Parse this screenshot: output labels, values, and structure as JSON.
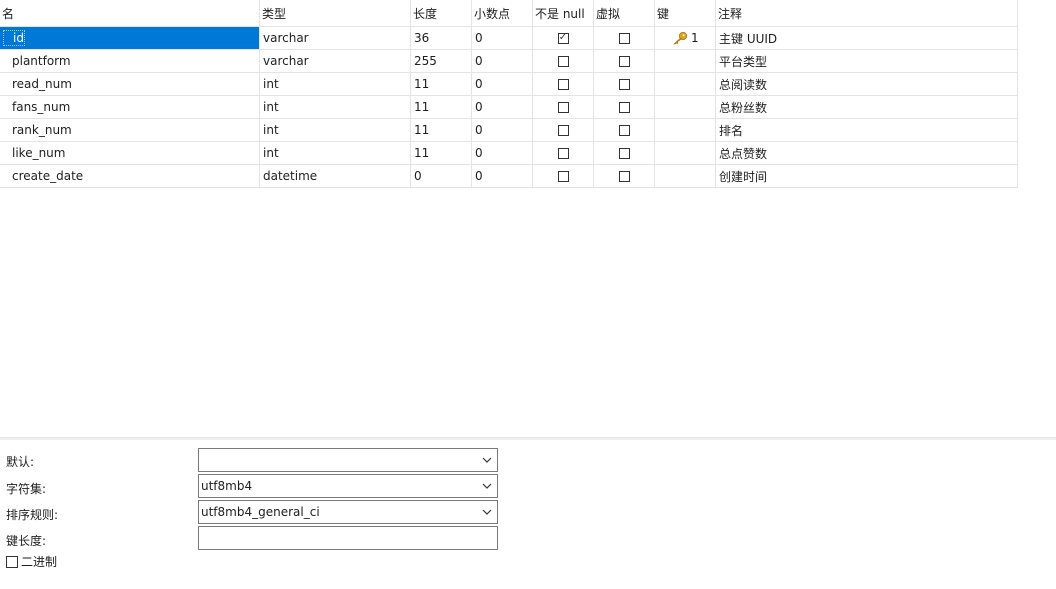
{
  "columns": {
    "name": "名",
    "type": "类型",
    "length": "长度",
    "decimals": "小数点",
    "not_null": "不是 null",
    "virtual": "虚拟",
    "key": "键",
    "comment": "注释"
  },
  "rows": [
    {
      "name": "id",
      "type": "varchar",
      "length": "36",
      "decimals": "0",
      "not_null": true,
      "virtual": false,
      "key": "1",
      "comment": "主键 UUID"
    },
    {
      "name": "plantform",
      "type": "varchar",
      "length": "255",
      "decimals": "0",
      "not_null": false,
      "virtual": false,
      "key": "",
      "comment": "平台类型"
    },
    {
      "name": "read_num",
      "type": "int",
      "length": "11",
      "decimals": "0",
      "not_null": false,
      "virtual": false,
      "key": "",
      "comment": "总阅读数"
    },
    {
      "name": "fans_num",
      "type": "int",
      "length": "11",
      "decimals": "0",
      "not_null": false,
      "virtual": false,
      "key": "",
      "comment": "总粉丝数"
    },
    {
      "name": "rank_num",
      "type": "int",
      "length": "11",
      "decimals": "0",
      "not_null": false,
      "virtual": false,
      "key": "",
      "comment": "排名"
    },
    {
      "name": "like_num",
      "type": "int",
      "length": "11",
      "decimals": "0",
      "not_null": false,
      "virtual": false,
      "key": "",
      "comment": "总点赞数"
    },
    {
      "name": "create_date",
      "type": "datetime",
      "length": "0",
      "decimals": "0",
      "not_null": false,
      "virtual": false,
      "key": "",
      "comment": "创建时间"
    }
  ],
  "properties": {
    "default_label": "默认:",
    "default_value": "",
    "charset_label": "字符集:",
    "charset_value": "utf8mb4",
    "collation_label": "排序规则:",
    "collation_value": "utf8mb4_general_ci",
    "key_length_label": "键长度:",
    "key_length_value": "",
    "binary_label": "二进制",
    "binary_checked": false
  },
  "icons": {
    "key": "key-icon",
    "row_marker": "row-pointer-icon",
    "dropdown": "chevron-down-icon"
  },
  "colors": {
    "selection": "#0078d7",
    "key_icon": "#e0a526"
  }
}
